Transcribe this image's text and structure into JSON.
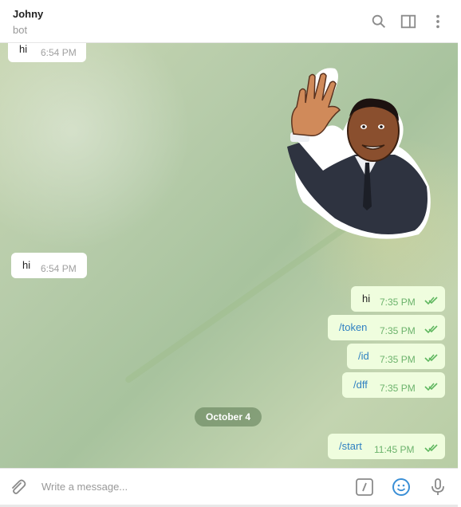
{
  "header": {
    "title": "Johny",
    "status": "bot",
    "icons": [
      "search-icon",
      "sidebar-toggle-icon",
      "more-vertical-icon"
    ]
  },
  "messages": [
    {
      "direction": "in",
      "text": "hi",
      "time": "6:54 PM"
    },
    {
      "direction": "in",
      "type": "sticker",
      "description": "waving man sticker"
    },
    {
      "direction": "in",
      "text": "hi",
      "time": "6:54 PM"
    },
    {
      "direction": "out",
      "text": "hi",
      "time": "7:35 PM",
      "read": true
    },
    {
      "direction": "out",
      "text": "/token",
      "time": "7:35 PM",
      "read": true
    },
    {
      "direction": "out",
      "text": "/id",
      "time": "7:35 PM",
      "read": true
    },
    {
      "direction": "out",
      "text": "/dff",
      "time": "7:35 PM",
      "read": true
    },
    {
      "direction": "out",
      "text": "/start",
      "time": "11:45 PM",
      "read": true
    }
  ],
  "date_separator": "October 4",
  "composer": {
    "placeholder": "Write a message...",
    "icons": [
      "attach-icon",
      "commands-icon",
      "emoji-icon",
      "microphone-icon"
    ]
  },
  "colors": {
    "incoming_bubble": "#ffffff",
    "outgoing_bubble": "#effdde",
    "time_outgoing": "#6cb36c",
    "command_link": "#2f80c2",
    "accent": "#3a8fd6"
  }
}
